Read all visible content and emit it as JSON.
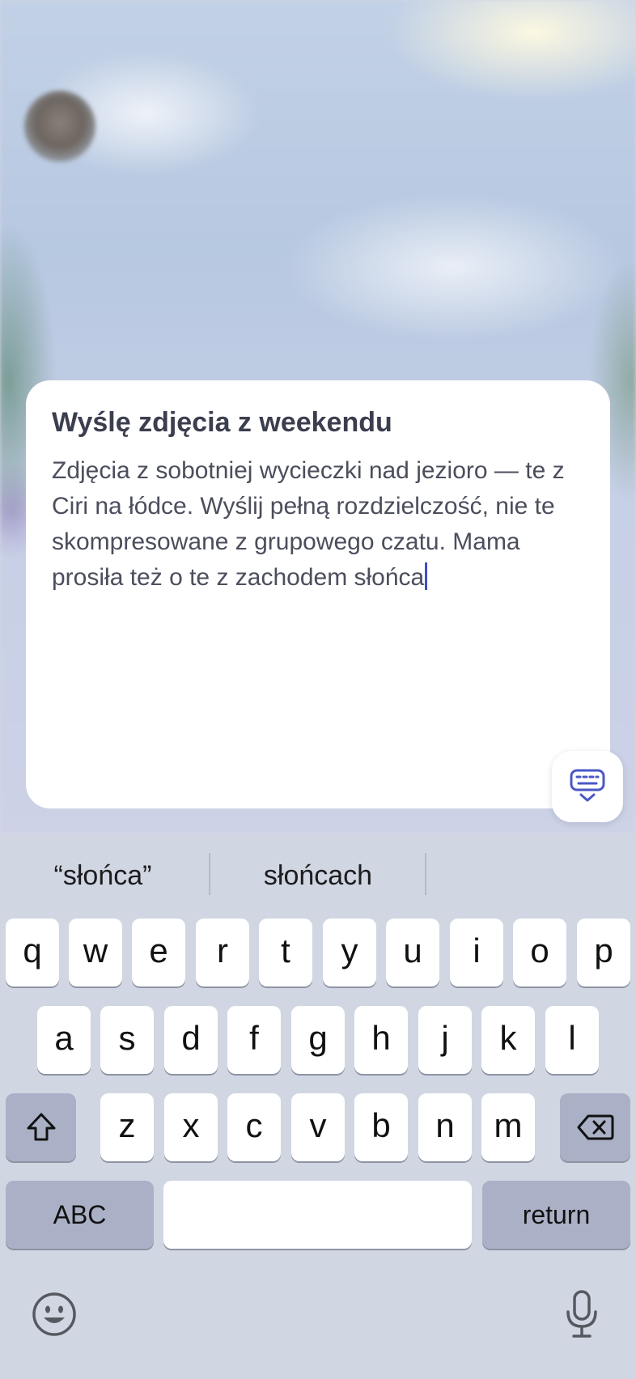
{
  "note": {
    "title": "Wyślę zdjęcia z weekendu",
    "body": "Zdjęcia z sobotniej wycieczki nad jezioro — te z Ciri na łódce. Wyślij pełną rozdzielczość, nie te skompresowane z grupowego czatu. Mama prosiła też o te z zachodem słońca"
  },
  "keyboard_toggle": {
    "icon": "keyboard-dismiss-icon"
  },
  "keyboard": {
    "suggestions": [
      "“słońca”",
      "słońcach",
      ""
    ],
    "row1": [
      "q",
      "w",
      "e",
      "r",
      "t",
      "y",
      "u",
      "i",
      "o",
      "p"
    ],
    "row2": [
      "a",
      "s",
      "d",
      "f",
      "g",
      "h",
      "j",
      "k",
      "l"
    ],
    "row3": [
      "z",
      "x",
      "c",
      "v",
      "b",
      "n",
      "m"
    ],
    "shift_icon": "shift-icon",
    "backspace_icon": "backspace-icon",
    "abc_label": "ABC",
    "space_label": "",
    "return_label": "return",
    "emoji_icon": "emoji-icon",
    "mic_icon": "microphone-icon"
  }
}
